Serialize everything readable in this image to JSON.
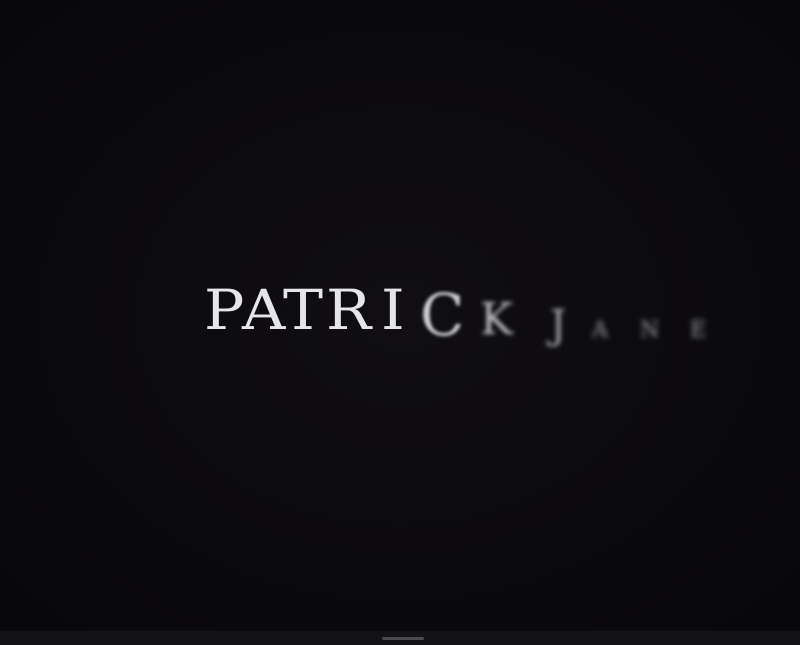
{
  "title": {
    "text": "PATRICK JANE",
    "letters": [
      "P",
      "A",
      "T",
      "R",
      "I",
      "C",
      "K",
      "J",
      "A",
      "N",
      "E"
    ]
  },
  "colors": {
    "background": "#0b0a0c",
    "title_text": "#e6e6e8",
    "bottom_bar": "#131214",
    "home_indicator": "#4a494d"
  }
}
